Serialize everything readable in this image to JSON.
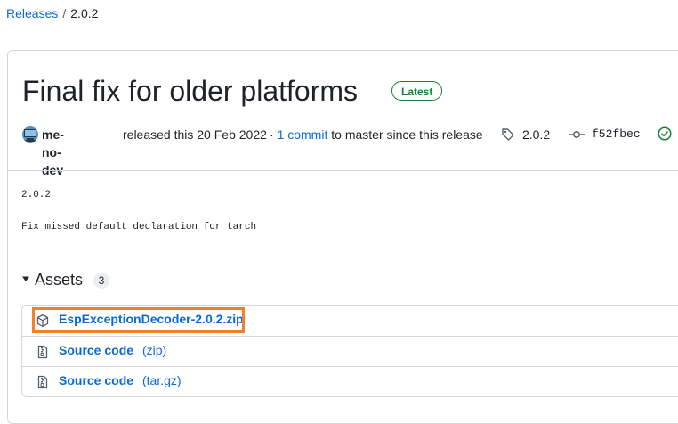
{
  "breadcrumb": {
    "root": "Releases",
    "separator": "/",
    "current": "2.0.2"
  },
  "release": {
    "title": "Final fix for older platforms",
    "badge": "Latest",
    "author": "me-no-dev",
    "released_text": "released this 20 Feb 2022",
    "commits_prefix": "·",
    "commits_link": "1 commit",
    "commits_suffix": "to master since this release",
    "tag": "2.0.2",
    "commit_sha": "f52fbec"
  },
  "notes": {
    "line1": "2.0.2",
    "line2": "Fix missed default declaration for tarch"
  },
  "assets": {
    "label": "Assets",
    "count": "3",
    "items": [
      {
        "name": "EspExceptionDecoder-2.0.2.zip",
        "sub": ""
      },
      {
        "name": "Source code",
        "sub": "(zip)"
      },
      {
        "name": "Source code",
        "sub": "(tar.gz)"
      }
    ]
  },
  "colors": {
    "link": "#0969da",
    "success": "#1a7f37",
    "border": "#d0d7de",
    "highlight": "#f0802a"
  }
}
